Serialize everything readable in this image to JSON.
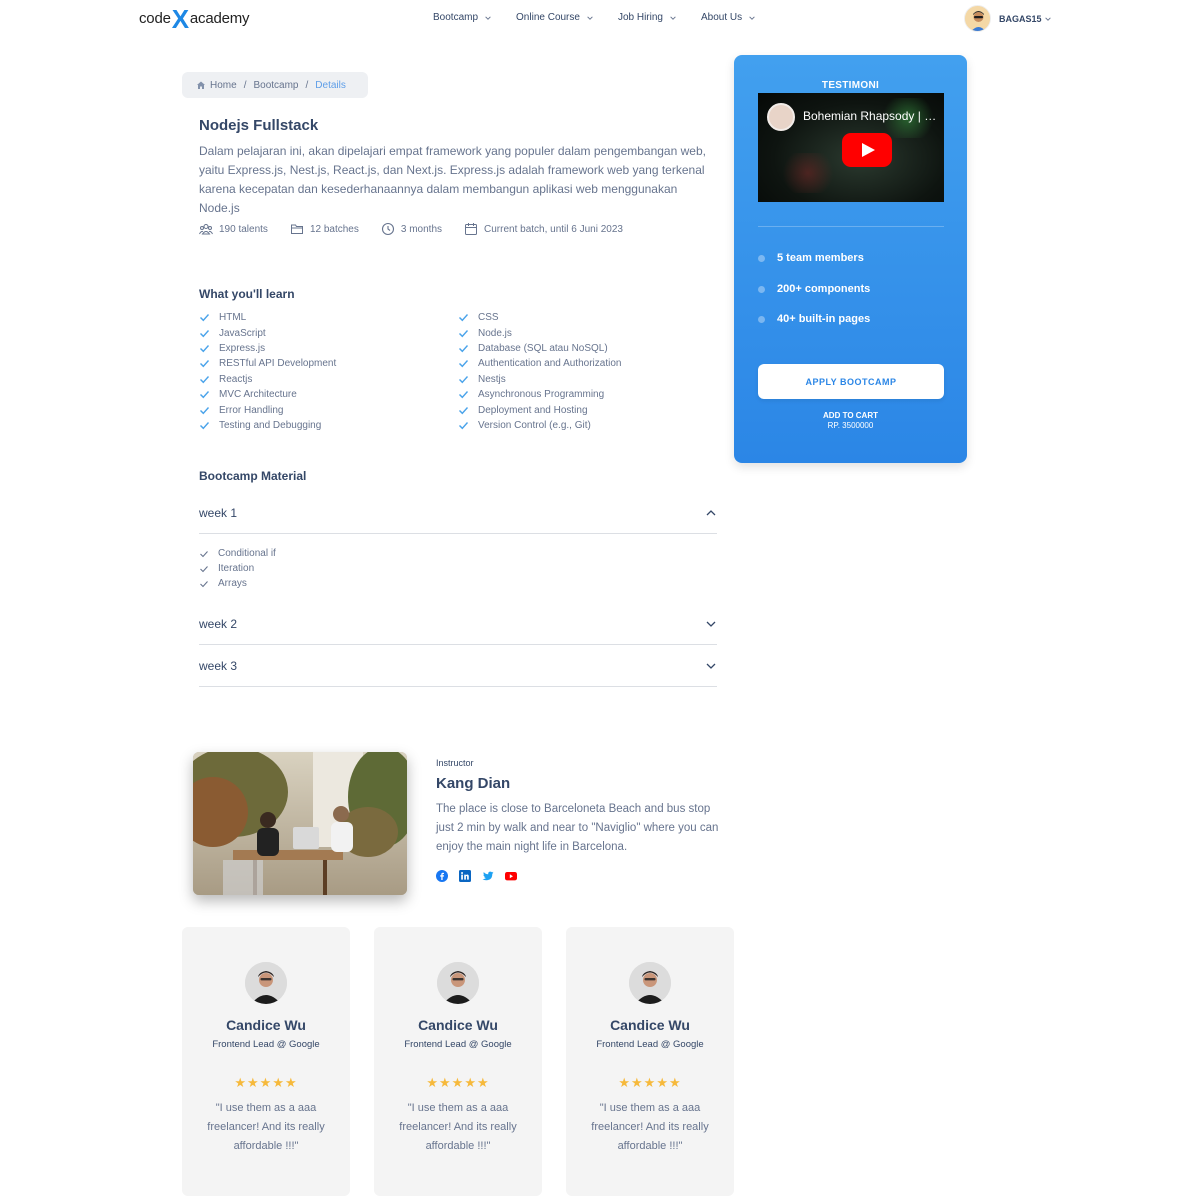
{
  "navbar": {
    "logo_left": "code",
    "logo_x": "X",
    "logo_right": "academy",
    "menu": [
      {
        "label": "Bootcamp"
      },
      {
        "label": "Online Course"
      },
      {
        "label": "Job Hiring"
      },
      {
        "label": "About Us"
      }
    ],
    "username": "BAGAS15"
  },
  "breadcrumb": {
    "items": [
      "Home",
      "Bootcamp",
      "Details"
    ],
    "separator": "/"
  },
  "course": {
    "title": "Nodejs Fullstack",
    "description": "Dalam pelajaran ini, akan dipelajari empat framework yang populer dalam pengembangan web, yaitu Express.js, Nest.js, React.js, dan Next.js. Express.js adalah framework web yang terkenal karena kecepatan dan kesederhanaannya dalam membangun aplikasi web menggunakan Node.js",
    "meta": {
      "talents": "190 talents",
      "batches": "12 batches",
      "duration": "3 months",
      "current_batch": "Current batch, until 6 Juni 2023"
    }
  },
  "learn": {
    "title": "What you'll learn",
    "left": [
      "HTML",
      "JavaScript",
      "Express.js",
      "RESTful API Development",
      "Reactjs",
      "MVC Architecture",
      "Error Handling",
      "Testing and Debugging"
    ],
    "right": [
      "CSS",
      "Node.js",
      "Database (SQL atau NoSQL)",
      "Authentication and Authorization",
      "Nestjs",
      "Asynchronous Programming",
      "Deployment and Hosting",
      "Version Control (e.g., Git)"
    ]
  },
  "material": {
    "title": "Bootcamp Material",
    "weeks": [
      {
        "label": "week 1",
        "expanded": true,
        "items": [
          "Conditional if",
          "Iteration",
          "Arrays"
        ]
      },
      {
        "label": "week 2",
        "expanded": false
      },
      {
        "label": "week 3",
        "expanded": false
      }
    ]
  },
  "testimoni": {
    "label": "TESTIMONI",
    "video_title": "Bohemian Rhapsody | Muppet Music Video | The Muppets",
    "features": [
      "5 team members",
      "200+ components",
      "40+ built-in pages"
    ],
    "apply_label": "APPLY BOOTCAMP",
    "cart_label": "ADD TO CART",
    "price": "RP. 3500000",
    "colors": {
      "card_top": "#42a0ef",
      "card_bottom": "#2b86e6"
    }
  },
  "instructor": {
    "label": "Instructor",
    "name": "Kang Dian",
    "bio": "The place is close to Barceloneta Beach and bus stop just 2 min by walk and near to \"Naviglio\" where you can enjoy the main night life in Barcelona.",
    "socials": [
      "facebook-icon",
      "linkedin-icon",
      "twitter-icon",
      "youtube-icon"
    ]
  },
  "reviews": [
    {
      "name": "Candice Wu",
      "role": "Frontend Lead @ Google",
      "stars": "★★★★★",
      "rating": 5,
      "quote": "\"I use them as a aaa freelancer! And its really affordable !!!\""
    },
    {
      "name": "Candice Wu",
      "role": "Frontend Lead @ Google",
      "stars": "★★★★★",
      "rating": 5,
      "quote": "\"I use them as a aaa freelancer! And its really affordable !!!\""
    },
    {
      "name": "Candice Wu",
      "role": "Frontend Lead @ Google",
      "stars": "★★★★★",
      "rating": 5,
      "quote": "\"I use them as a aaa freelancer! And its really affordable !!!\""
    }
  ]
}
